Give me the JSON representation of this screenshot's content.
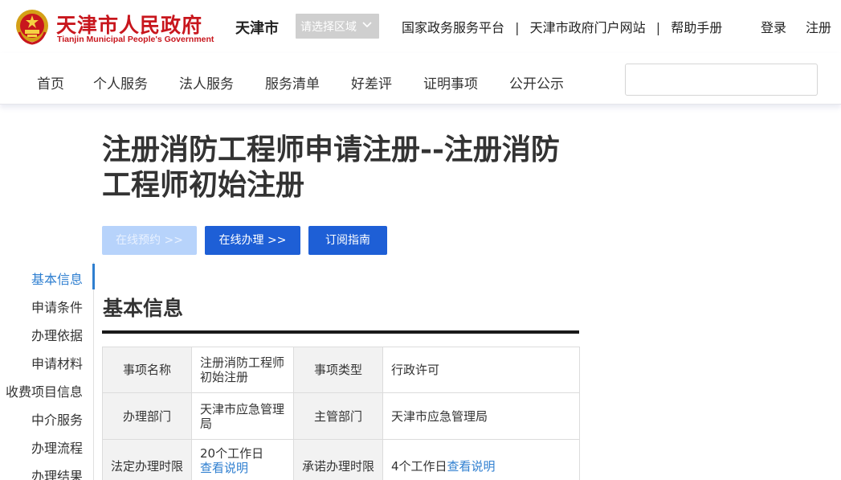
{
  "header": {
    "logo_cn": "天津市人民政府",
    "logo_en": "Tianjin Municipal People's Government",
    "city": "天津市",
    "region_select": "请选择区域",
    "links": [
      "国家政务服务平台",
      "天津市政府门户网站",
      "帮助手册"
    ],
    "separator": "|",
    "login": "登录",
    "register": "注册"
  },
  "nav": {
    "items": [
      "首页",
      "个人服务",
      "法人服务",
      "服务清单",
      "好差评",
      "证明事项",
      "公开公示"
    ],
    "search_placeholder": ""
  },
  "page": {
    "title": "注册消防工程师申请注册--注册消防工程师初始注册"
  },
  "actions": {
    "appoint": "在线预约 >>",
    "online": "在线办理 >>",
    "subscribe": "订阅指南"
  },
  "sidenav": {
    "items": [
      "基本信息",
      "申请条件",
      "办理依据",
      "申请材料",
      "收费项目信息",
      "中介服务",
      "办理流程",
      "办理结果"
    ],
    "active_index": 0
  },
  "section": {
    "title": "基本信息"
  },
  "table": {
    "rows": [
      {
        "l1": "事项名称",
        "v1": "注册消防工程师初始注册",
        "l2": "事项类型",
        "v2": "行政许可"
      },
      {
        "l1": "办理部门",
        "v1": "天津市应急管理局",
        "l2": "主管部门",
        "v2": "天津市应急管理局"
      },
      {
        "l1": "法定办理时限",
        "v1": "20个工作日",
        "v1_link": "查看说明",
        "l2": "承诺办理时限",
        "v2": "4个工作日",
        "v2_link": "查看说明"
      }
    ]
  },
  "colors": {
    "brand_red": "#c8161d",
    "primary_blue": "#1e5fd6",
    "link_blue": "#2f7fd0",
    "disabled_blue": "#b7d3fb"
  }
}
